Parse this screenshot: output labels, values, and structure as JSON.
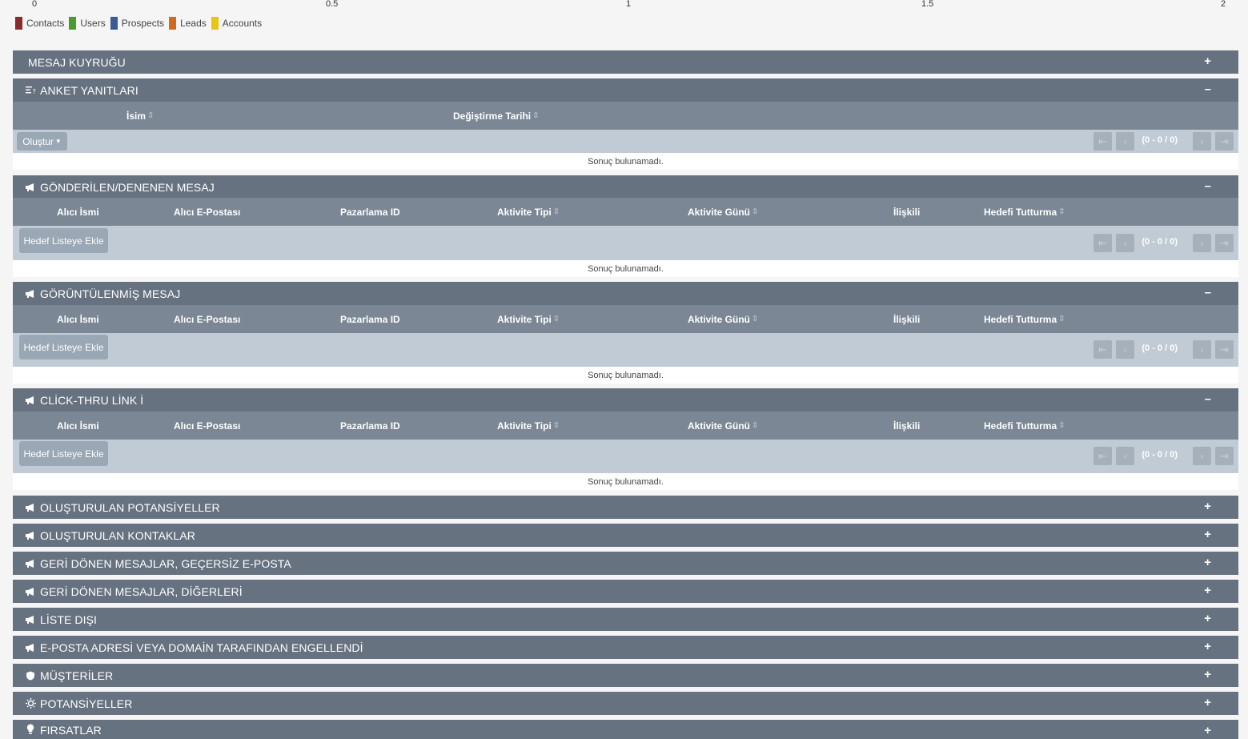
{
  "axis": {
    "ticks": [
      "0",
      "0.5",
      "1",
      "1.5",
      "2"
    ]
  },
  "legend": [
    {
      "label": "Contacts",
      "color": "#8b2a2a"
    },
    {
      "label": "Users",
      "color": "#4a9a2e"
    },
    {
      "label": "Prospects",
      "color": "#3a5a93"
    },
    {
      "label": "Leads",
      "color": "#d06a1c"
    },
    {
      "label": "Accounts",
      "color": "#e8c31a"
    }
  ],
  "common": {
    "plus": "+",
    "minus": "–",
    "no_results": "Sonuç bulunamadı.",
    "page_count": "(0 - 0 / 0)",
    "add_to_target_list": "Hedef Listeye Ekle",
    "create": "Oluştur"
  },
  "panels": {
    "mesaj_kuyrugu": {
      "title": "MESAJ KUYRUĞU"
    },
    "anket_yanitlari": {
      "title": "ANKET YANITLARI",
      "columns": [
        "İsim",
        "Değiştirme Tarihi"
      ]
    },
    "gonderilen": {
      "title": "GÖNDERİLEN/DENENEN MESAJ"
    },
    "goruntulenmis": {
      "title": "GÖRÜNTÜLENMİŞ MESAJ"
    },
    "click_thru": {
      "title": "CLİCK-THRU LİNK İ"
    },
    "olusturulan_potansiyeller": {
      "title": "OLUŞTURULAN POTANSİYELLER"
    },
    "olusturulan_kontaklar": {
      "title": "OLUŞTURULAN KONTAKLAR"
    },
    "geri_donen_gecersiz": {
      "title": "GERİ DÖNEN MESAJLAR, GEÇERSİZ E-POSTA"
    },
    "geri_donen_digerleri": {
      "title": "GERİ DÖNEN MESAJLAR, DİĞERLERİ"
    },
    "liste_disi": {
      "title": "LİSTE DIŞI"
    },
    "engellendi": {
      "title": "E-POSTA ADRESİ VEYA DOMAİN TARAFINDAN ENGELLENDİ"
    },
    "musteriler": {
      "title": "MÜŞTERİLER"
    },
    "potansiyeller": {
      "title": "POTANSİYELLER"
    },
    "firsatlar": {
      "title": "FIRSATLAR"
    }
  },
  "activity_columns": [
    "Alıcı İsmi",
    "Alıcı E-Postası",
    "Pazarlama ID",
    "Aktivite Tipi",
    "Aktivite Günü",
    "İlişkili",
    "Hedefi Tutturma"
  ]
}
